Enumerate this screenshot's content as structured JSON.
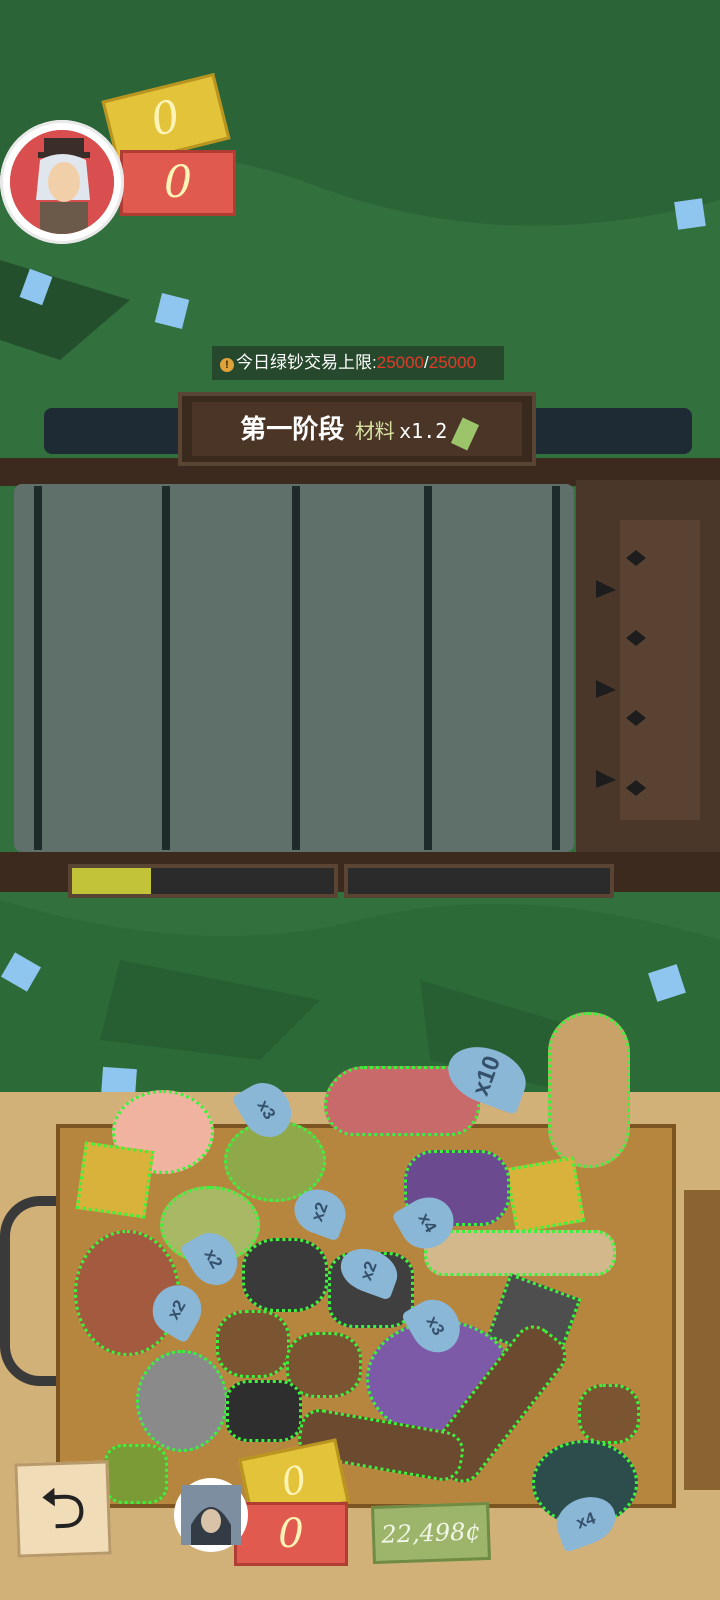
{
  "header": {
    "score_yellow": "0",
    "score_red": "0"
  },
  "trade_limit": {
    "label": "今日绿钞交易上限:",
    "current": "25000",
    "separator": "/",
    "max": "25000"
  },
  "stage": {
    "title": "第一阶段",
    "material_label": "材料",
    "multiplier": "x1.2"
  },
  "progress": {
    "fill": 0.3
  },
  "items": [
    {
      "name": "meat",
      "tag": "x10"
    },
    {
      "name": "mushroom",
      "tag": "x3"
    },
    {
      "name": "egg",
      "tag": "x2"
    },
    {
      "name": "sushi-roll",
      "tag": "x2"
    },
    {
      "name": "rock",
      "tag": "x2"
    },
    {
      "name": "purple-tentacle",
      "tag": "x4"
    },
    {
      "name": "pot",
      "tag": "x2"
    },
    {
      "name": "purple-pot",
      "tag": "x3"
    },
    {
      "name": "teal-stone",
      "tag": "x4"
    }
  ],
  "bottom_bar": {
    "score_yellow": "0",
    "score_red": "0",
    "money": "22,498¢"
  },
  "colors": {
    "accent_green": "#3df23d",
    "limit_red": "#e53a2a"
  }
}
